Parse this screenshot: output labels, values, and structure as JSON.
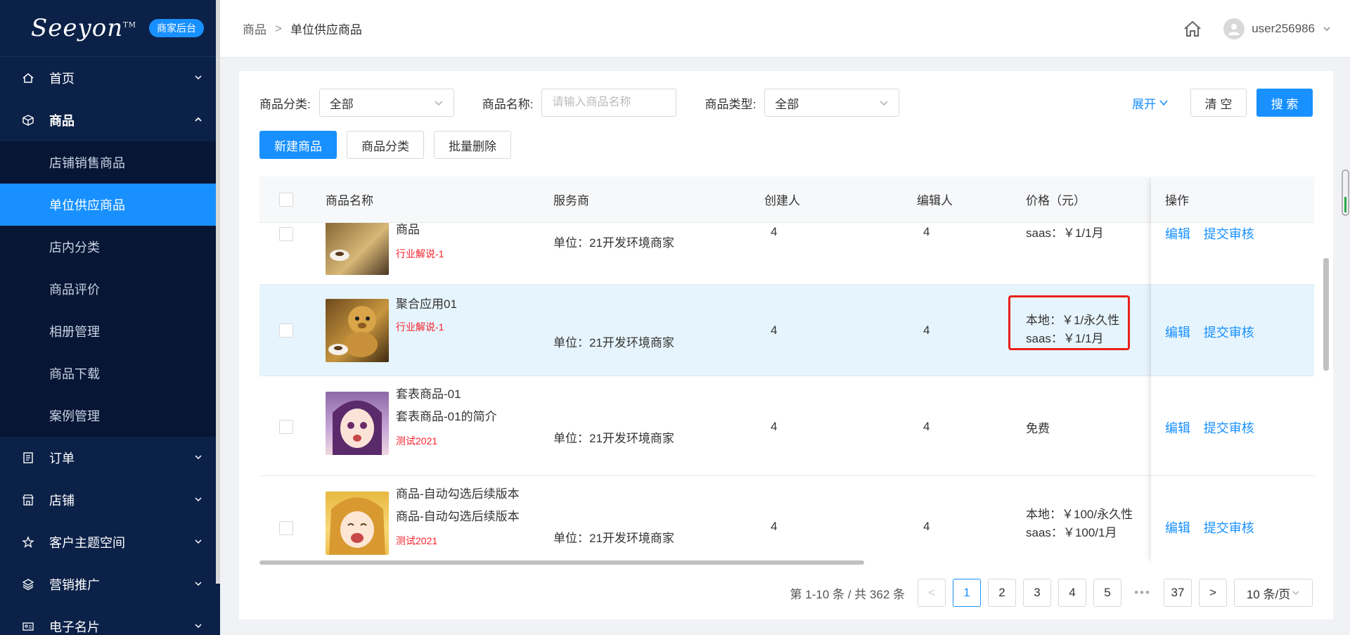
{
  "sidebar": {
    "logo": "Seeyon",
    "logo_tm": "TM",
    "badge": "商家后台",
    "menu": [
      {
        "label": "首页",
        "icon": "home-icon"
      },
      {
        "label": "商品",
        "icon": "cube-icon"
      },
      {
        "label": "订单",
        "icon": "document-icon"
      },
      {
        "label": "店铺",
        "icon": "store-icon"
      },
      {
        "label": "客户主题空间",
        "icon": "star-icon"
      },
      {
        "label": "营销推广",
        "icon": "layers-icon"
      },
      {
        "label": "电子名片",
        "icon": "card-icon"
      }
    ],
    "submenu": [
      "店铺销售商品",
      "单位供应商品",
      "店内分类",
      "商品评价",
      "相册管理",
      "商品下载",
      "案例管理"
    ]
  },
  "header": {
    "crumb_root": "商品",
    "crumb_sep": ">",
    "crumb_current": "单位供应商品",
    "username": "user256986"
  },
  "filters": {
    "category_label": "商品分类:",
    "category_value": "全部",
    "name_label": "商品名称:",
    "name_placeholder": "请输入商品名称",
    "type_label": "商品类型:",
    "type_value": "全部",
    "expand": "展开",
    "clear": "清 空",
    "search": "搜 索"
  },
  "actions": {
    "new": "新建商品",
    "category": "商品分类",
    "batch_delete": "批量删除"
  },
  "table": {
    "headers": [
      "商品名称",
      "服务商",
      "创建人",
      "编辑人",
      "价格（元）",
      "操作"
    ],
    "rows": [
      {
        "name1": "商品",
        "name2": "",
        "tag": "行业解说-1",
        "vendor": "单位：21开发环境商家",
        "creator": "4",
        "editor": "4",
        "price1": "saas：￥1/1月",
        "price2": "",
        "edit": "编辑",
        "submit": "提交审核"
      },
      {
        "name1": "聚合应用01",
        "name2": "",
        "tag": "行业解说-1",
        "vendor": "单位：21开发环境商家",
        "creator": "4",
        "editor": "4",
        "price1": "本地：￥1/永久性",
        "price2": "saas：￥1/1月",
        "edit": "编辑",
        "submit": "提交审核"
      },
      {
        "name1": "套表商品-01",
        "name2": "套表商品-01的简介",
        "tag": "测试2021",
        "vendor": "单位：21开发环境商家",
        "creator": "4",
        "editor": "4",
        "price1": "免费",
        "price2": "",
        "edit": "编辑",
        "submit": "提交审核"
      },
      {
        "name1": "商品-自动勾选后续版本",
        "name2": "商品-自动勾选后续版本",
        "tag": "测试2021",
        "vendor": "单位：21开发环境商家",
        "creator": "4",
        "editor": "4",
        "price1": "本地：￥100/永久性",
        "price2": "saas：￥100/1月",
        "edit": "编辑",
        "submit": "提交审核"
      }
    ]
  },
  "pagination": {
    "total": "第 1-10 条 / 共 362 条",
    "prev": "<",
    "pages": [
      "1",
      "2",
      "3",
      "4",
      "5"
    ],
    "dots": "•••",
    "last": "37",
    "next": ">",
    "size": "10 条/页"
  },
  "colors": {
    "sidebar_bg": "#0c2148",
    "primary": "#1890ff",
    "highlight_row": "#e6f4fd",
    "tag_red": "#f5222d",
    "annotation_red": "#e8221a"
  }
}
